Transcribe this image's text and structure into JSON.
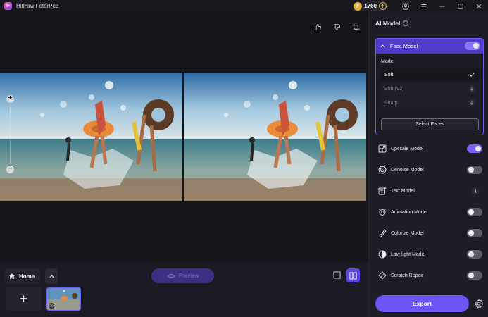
{
  "app": {
    "title": "HitPaw FotorPea",
    "logo_letter": "P"
  },
  "titlebar": {
    "credits": "1760",
    "credits_add": "+"
  },
  "canvas": {
    "photo_alt": "beach photo",
    "zoom_in": "+",
    "zoom_out": "−"
  },
  "bottom": {
    "home_label": "Home",
    "preview_label": "Preview",
    "add_label": "+"
  },
  "panel": {
    "title": "AI Model",
    "face_model": {
      "label": "Face Model",
      "enabled": true,
      "mode_label": "Mode",
      "options": [
        {
          "label": "Soft",
          "state": "selected"
        },
        {
          "label": "Soft (V2)",
          "state": "download"
        },
        {
          "label": "Sharp",
          "state": "download"
        }
      ],
      "select_faces_label": "Select Faces"
    },
    "models": [
      {
        "label": "Upscale Model",
        "icon": "upscale-icon",
        "control": "toggle",
        "enabled": true
      },
      {
        "label": "Denoise Model",
        "icon": "denoise-icon",
        "control": "toggle",
        "enabled": false
      },
      {
        "label": "Text Model",
        "icon": "text-model-icon",
        "control": "download",
        "enabled": false
      },
      {
        "label": "Animation Model",
        "icon": "animation-icon",
        "control": "toggle",
        "enabled": false
      },
      {
        "label": "Colorize Model",
        "icon": "colorize-icon",
        "control": "toggle",
        "enabled": false
      },
      {
        "label": "Low-light Model",
        "icon": "low-light-icon",
        "control": "toggle",
        "enabled": false
      },
      {
        "label": "Scratch Repair",
        "icon": "scratch-repair-icon",
        "control": "toggle",
        "enabled": false
      }
    ],
    "export_label": "Export"
  },
  "colors": {
    "accent": "#6a55f7",
    "accent_header": "#4f3ccb",
    "coin": "#e2ae3a",
    "panel_bg": "#1d1d26"
  }
}
